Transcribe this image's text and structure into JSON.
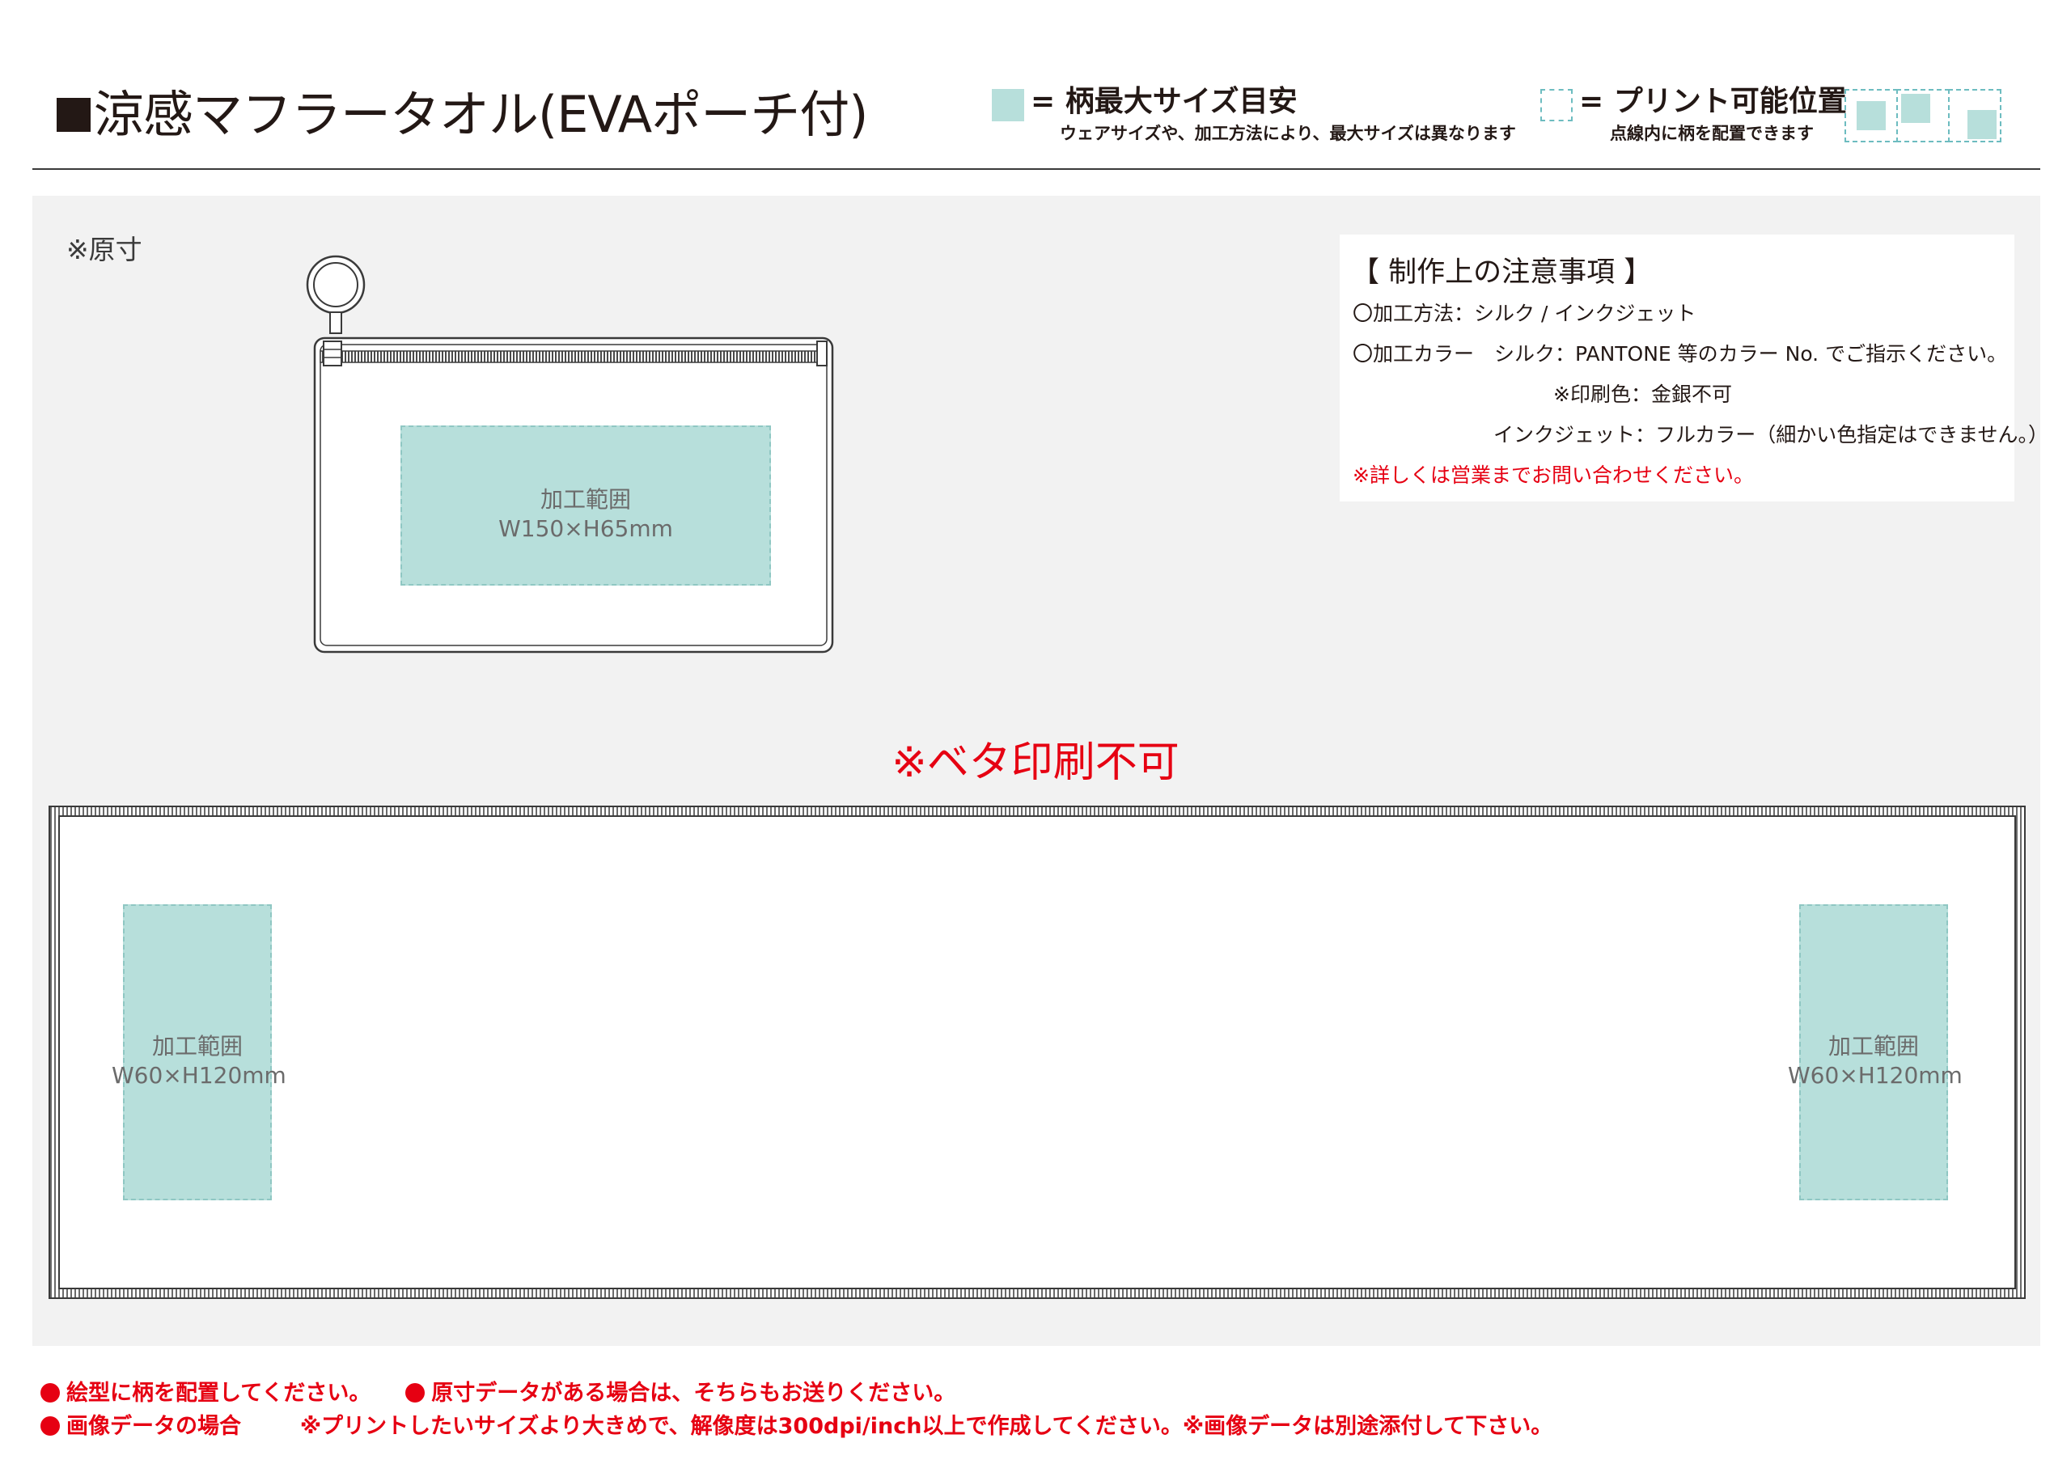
{
  "header": {
    "title": "涼感マフラータオル(EVAポーチ付)",
    "legend_max": {
      "label": "= 柄最大サイズ目安",
      "sub": "ウェアサイズや、加工方法により、最大サイズは異なります"
    },
    "legend_print": {
      "label": "= プリント可能位置",
      "sub": "点線内に柄を配置できます"
    }
  },
  "main": {
    "genzun": "※原寸",
    "pouch_area": {
      "label": "加工範囲",
      "size": "W150×H65mm"
    },
    "beta_warning": "※ベタ印刷不可",
    "towel_left_area": {
      "label": "加工範囲",
      "size": "W60×H120mm"
    },
    "towel_right_area": {
      "label": "加工範囲",
      "size": "W60×H120mm"
    }
  },
  "notes": {
    "title": "【 制作上の注意事項 】",
    "line1": "〇加工方法：シルク / インクジェット",
    "line2": "〇加工カラー　シルク：PANTONE 等のカラー No. でご指示ください。",
    "line3": "※印刷色：金銀不可",
    "line4": "インクジェット：フルカラー（細かい色指定はできません。）",
    "line5": "※詳しくは営業までお問い合わせください。"
  },
  "footer": {
    "item1": "絵型に柄を配置してください。",
    "item2": "原寸データがある場合は、そちらもお送りください。",
    "item3": "画像データの場合",
    "item3_detail": "※プリントしたいサイズより大きめで、解像度は300dpi/inch以上で作成してください。※画像データは別途添付して下さい。"
  },
  "colors": {
    "print_area": "#b7dfdb",
    "dashed": "#6dbcc0",
    "warning_red": "#e60012",
    "panel": "#f2f2f2"
  }
}
